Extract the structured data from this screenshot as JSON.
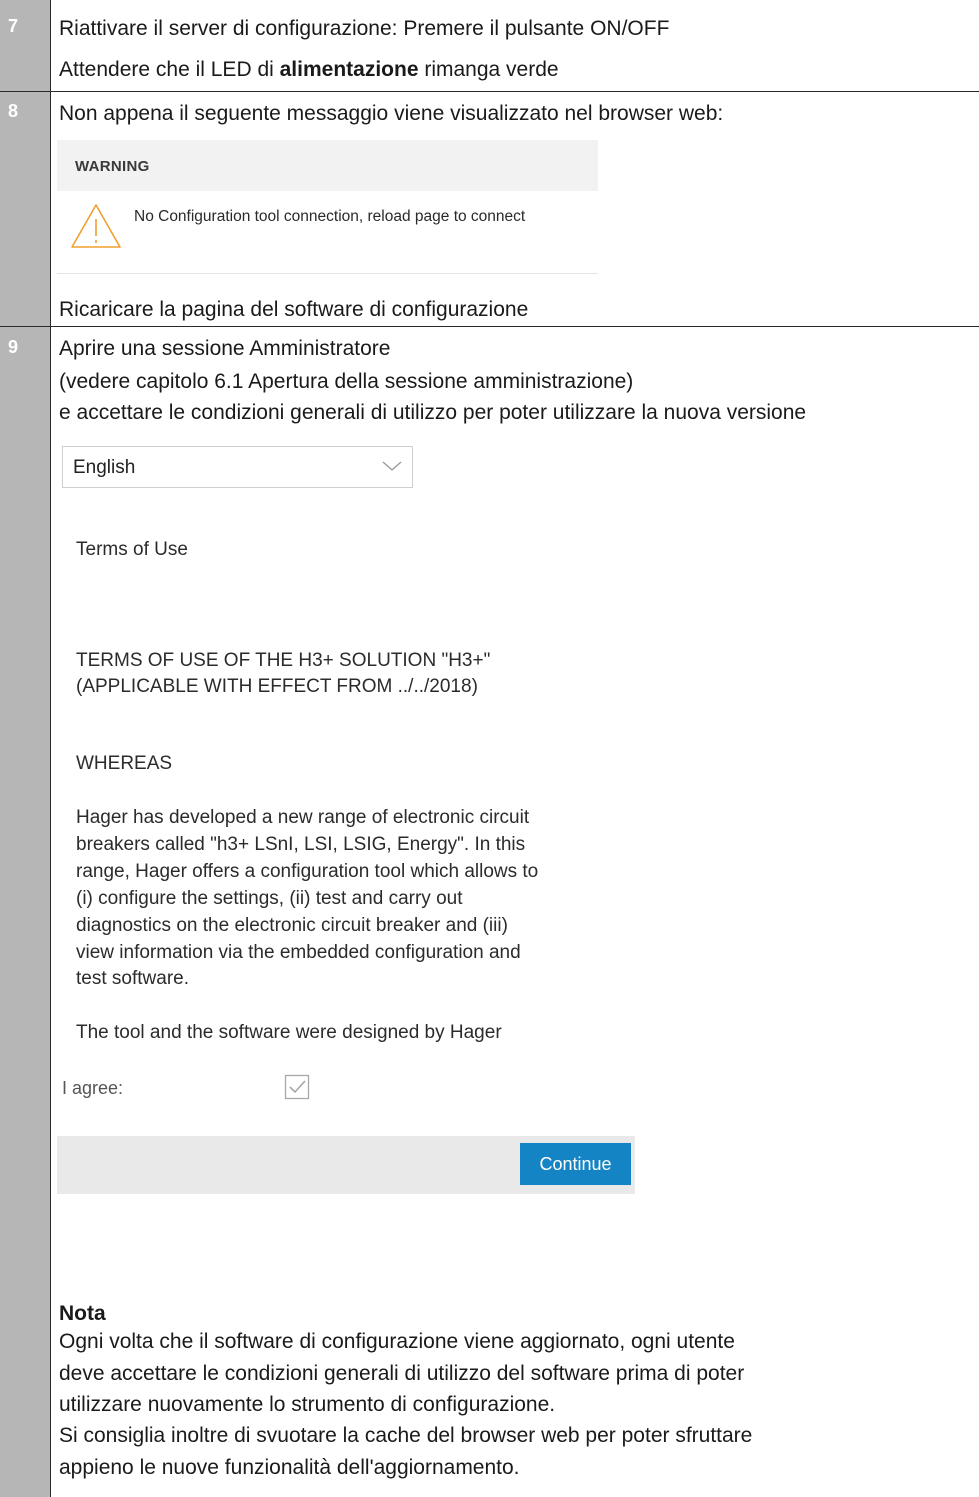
{
  "steps": [
    {
      "number": "7",
      "lines": [
        "Riattivare il server di configurazione: Premere il pulsante ON/OFF"
      ],
      "led_prefix": "Attendere che il LED di ",
      "led_bold": "alimentazione",
      "led_suffix": " rimanga verde"
    },
    {
      "number": "8",
      "intro": "Non appena il seguente messaggio viene visualizzato nel browser web:",
      "after": "Ricaricare la pagina del software di configurazione"
    },
    {
      "number": "9",
      "lines": [
        "Aprire una sessione Amministratore",
        "(vedere capitolo 6.1 Apertura della sessione amministrazione)",
        "e accettare le condizioni generali di utilizzo per poter utilizzare la nuova versione"
      ]
    }
  ],
  "warning": {
    "title": "WARNING",
    "message": "No Configuration tool connection, reload page to connect",
    "icon": "warning-triangle-icon",
    "icon_color": "#f0a030"
  },
  "terms": {
    "language": "English",
    "heading": "Terms of Use",
    "title_lines": [
      "TERMS OF USE OF THE H3+ SOLUTION \"H3+\"",
      "(APPLICABLE WITH EFFECT FROM ../../2018)"
    ],
    "whereas": "WHEREAS",
    "paragraph": [
      "Hager has developed a new range of electronic circuit",
      "breakers called \"h3+ LSnI, LSI, LSIG, Energy\". In this",
      "range, Hager offers a configuration tool which allows to",
      "(i) configure the settings, (ii) test and carry out",
      "diagnostics on the electronic circuit breaker and (iii)",
      "view information via the embedded configuration and",
      "test software."
    ],
    "last_line": "The tool and the software were designed by Hager",
    "agree_label": "I agree:",
    "agree_checked": true,
    "continue_label": "Continue",
    "button_color": "#1584c4"
  },
  "note": {
    "title": "Nota",
    "lines": [
      "Ogni volta che il software di configurazione viene aggiornato, ogni utente",
      "deve accettare le condizioni generali di utilizzo del software prima di poter",
      "utilizzare nuovamente lo strumento di configurazione.",
      "Si consiglia inoltre di svuotare la cache del browser web per poter sfruttare",
      "appieno le nuove funzionalità dell'aggiornamento."
    ]
  }
}
